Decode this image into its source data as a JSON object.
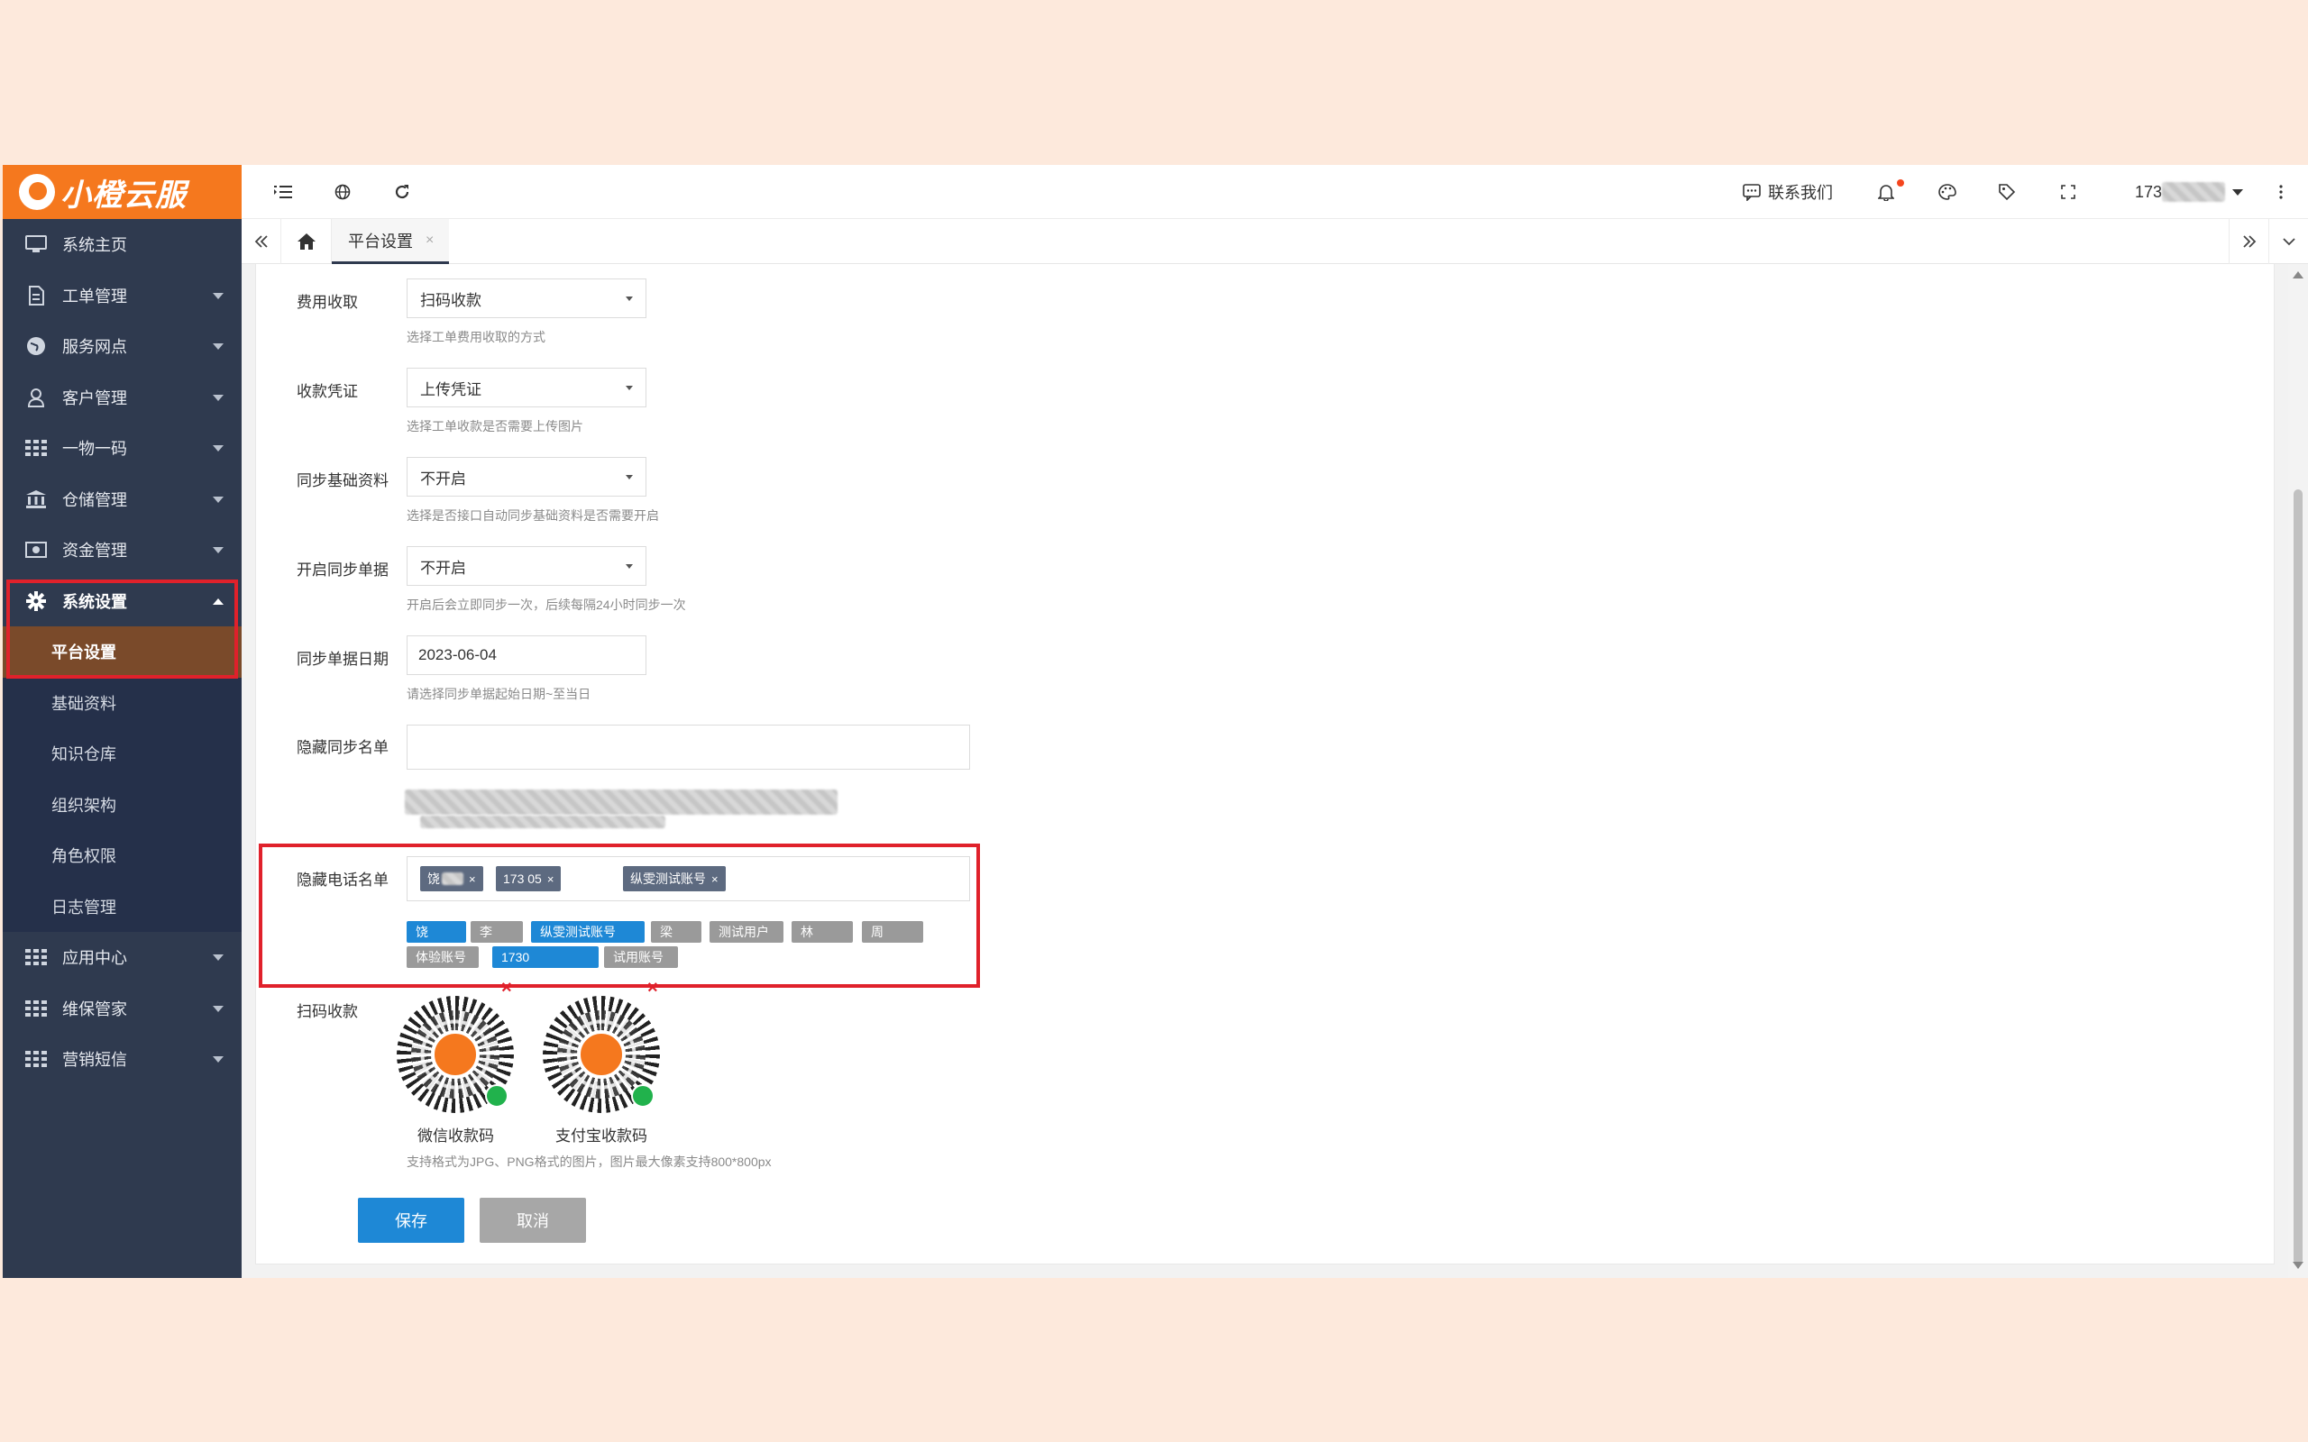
{
  "brand": {
    "name": "小橙云服",
    "color": "#f5781e"
  },
  "sidebar": {
    "items": [
      {
        "label": "系统主页",
        "icon": "monitor-icon",
        "arrow": false
      },
      {
        "label": "工单管理",
        "icon": "document-icon",
        "arrow": true
      },
      {
        "label": "服务网点",
        "icon": "globe-icon",
        "arrow": true
      },
      {
        "label": "客户管理",
        "icon": "user-icon",
        "arrow": true
      },
      {
        "label": "一物一码",
        "icon": "grid-icon",
        "arrow": true
      },
      {
        "label": "仓储管理",
        "icon": "bank-icon",
        "arrow": true
      },
      {
        "label": "资金管理",
        "icon": "money-icon",
        "arrow": true
      },
      {
        "label": "系统设置",
        "icon": "gear-icon",
        "arrow": true,
        "expanded": true
      }
    ],
    "submenu": [
      {
        "label": "平台设置",
        "current": true
      },
      {
        "label": "基础资料"
      },
      {
        "label": "知识仓库"
      },
      {
        "label": "组织架构"
      },
      {
        "label": "角色权限"
      },
      {
        "label": "日志管理"
      }
    ],
    "bottom_items": [
      {
        "label": "应用中心",
        "icon": "grid-icon"
      },
      {
        "label": "维保管家",
        "icon": "grid-icon"
      },
      {
        "label": "营销短信",
        "icon": "grid-icon"
      }
    ]
  },
  "topbar": {
    "contact_label": "联系我们",
    "user_prefix": "173"
  },
  "tabs": [
    {
      "label": "平台设置",
      "close": "×"
    }
  ],
  "form": {
    "fee": {
      "label": "费用收取",
      "value": "扫码收款",
      "help": "选择工单费用收取的方式"
    },
    "voucher": {
      "label": "收款凭证",
      "value": "上传凭证",
      "help": "选择工单收款是否需要上传图片"
    },
    "sync_basic": {
      "label": "同步基础资料",
      "value": "不开启",
      "help": "选择是否接口自动同步基础资料是否需要开启"
    },
    "sync_orders": {
      "label": "开启同步单据",
      "value": "不开启",
      "help": "开启后会立即同步一次，后续每隔24小时同步一次"
    },
    "sync_date": {
      "label": "同步单据日期",
      "value": "2023-06-04",
      "help": "请选择同步单据起始日期~至当日"
    },
    "hide_sync": {
      "label": "隐藏同步名单"
    },
    "hide_phone": {
      "label": "隐藏电话名单",
      "tags": [
        "饶",
        "173 05",
        "纵雯测试账号"
      ],
      "tag_close": "×",
      "chips": [
        {
          "label": "饶",
          "selected": true
        },
        {
          "label": "李",
          "selected": false
        },
        {
          "label": "纵雯测试账号",
          "selected": true
        },
        {
          "label": "梁",
          "selected": false
        },
        {
          "label": "测试用户",
          "selected": false
        },
        {
          "label": "林",
          "selected": false
        },
        {
          "label": "周",
          "selected": false
        },
        {
          "label": "体验账号",
          "selected": false
        },
        {
          "label": "1730",
          "selected": true
        },
        {
          "label": "试用账号",
          "selected": false
        }
      ]
    },
    "qr": {
      "label": "扫码收款",
      "wechat_caption": "微信收款码",
      "alipay_caption": "支付宝收款码",
      "delete_mark": "×",
      "help": "支持格式为JPG、PNG格式的图片，图片最大像素支持800*800px"
    },
    "save_label": "保存",
    "cancel_label": "取消"
  }
}
